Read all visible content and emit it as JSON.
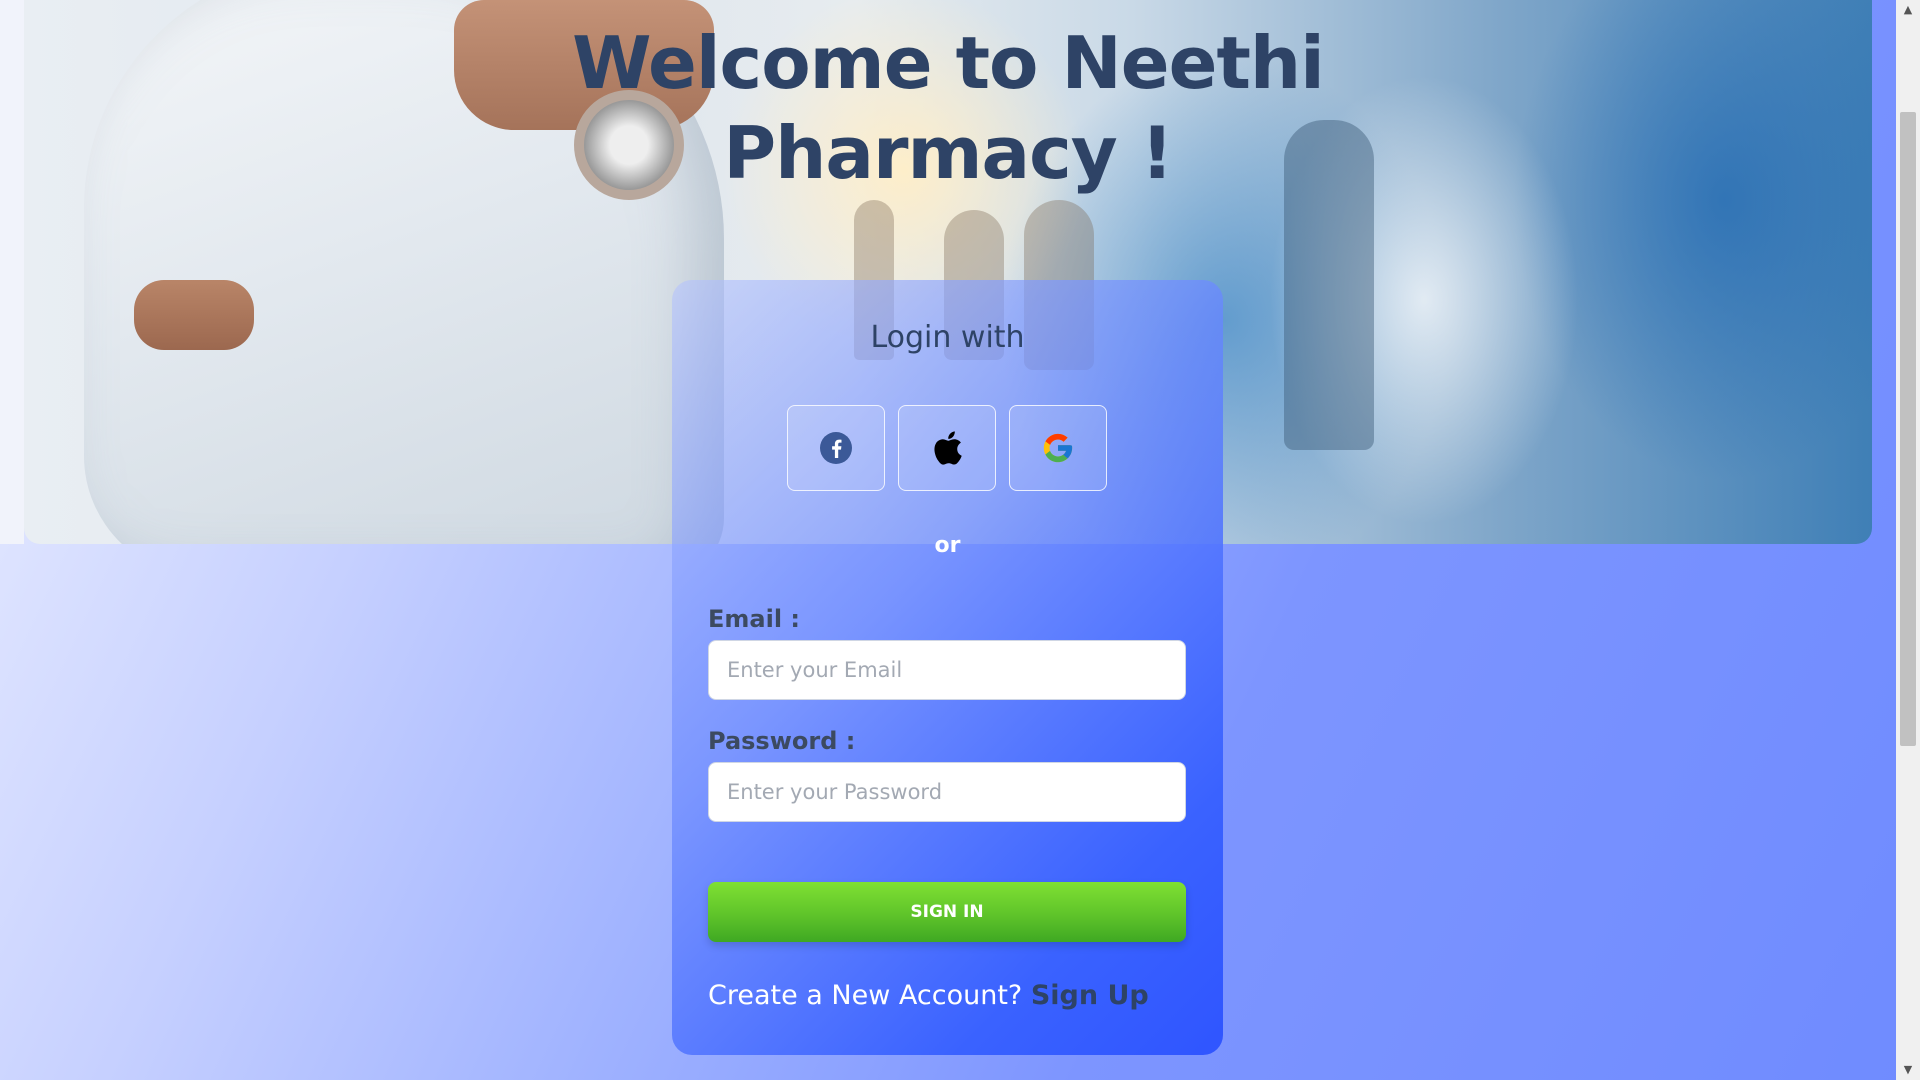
{
  "hero": {
    "title_line1": "Welcome to Neethi",
    "title_line2": "Pharmacy !"
  },
  "login": {
    "heading": "Login with",
    "social": [
      {
        "name": "facebook",
        "icon": "facebook-icon"
      },
      {
        "name": "apple",
        "icon": "apple-icon"
      },
      {
        "name": "google",
        "icon": "google-icon"
      }
    ],
    "divider": "or",
    "email_label": "Email :",
    "email_placeholder": "Enter your Email",
    "email_value": "",
    "password_label": "Password :",
    "password_placeholder": "Enter your Password",
    "password_value": "",
    "signin_label": "SIGN IN",
    "signup_prompt": "Create a New Account?",
    "signup_link": "Sign Up"
  },
  "colors": {
    "title": "#2e4366",
    "signin_button": "#5fc42a",
    "card_gradient_end": "#2f55ff",
    "page_gradient_start": "#eef1ff",
    "page_gradient_end": "#6f8bff"
  }
}
